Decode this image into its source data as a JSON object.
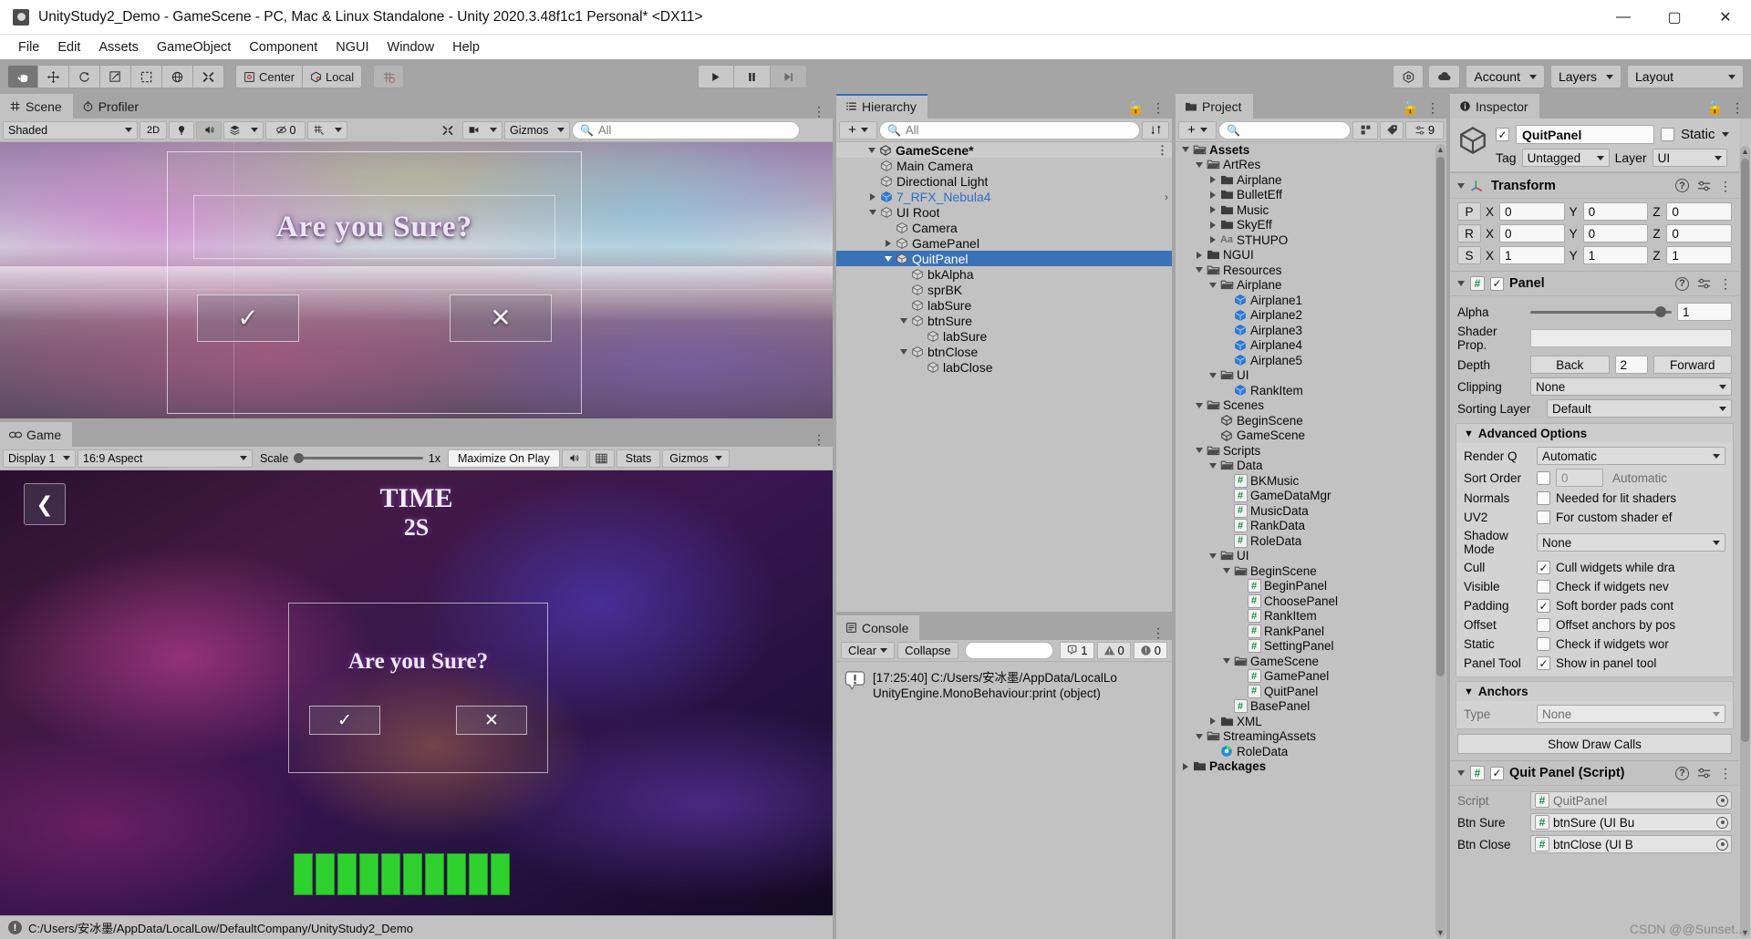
{
  "window": {
    "title": "UnityStudy2_Demo - GameScene - PC, Mac & Linux Standalone - Unity 2020.3.48f1c1 Personal* <DX11>",
    "minimize": "—",
    "maximize": "▢",
    "close": "✕"
  },
  "menu": {
    "items": [
      "File",
      "Edit",
      "Assets",
      "GameObject",
      "Component",
      "NGUI",
      "Window",
      "Help"
    ]
  },
  "toolbar": {
    "tools": [
      "hand-tool",
      "move-tool",
      "rotate-tool",
      "scale-tool",
      "rect-tool",
      "transform-tool",
      "custom-tool"
    ],
    "pivot_label": "Center",
    "space_label": "Local",
    "snap_label": "",
    "play": "▶",
    "pause": "❚❚",
    "step": "▶|",
    "collab_label": "",
    "account_label": "Account",
    "layers_label": "Layers",
    "layout_label": "Layout"
  },
  "scene_panel": {
    "tabs": [
      {
        "label": "Scene",
        "icon": "grid-icon",
        "selected": true
      },
      {
        "label": "Profiler",
        "icon": "stopwatch-icon",
        "selected": false
      }
    ],
    "toolbar": {
      "draw_mode": "Shaded",
      "two_d": "2D",
      "lighting": "light-icon",
      "audio": "audio-icon",
      "fx": "fx-icon",
      "hidden_count": "0",
      "grid": "grid-visibility-icon",
      "gizmos": "Gizmos",
      "search_placeholder": "All"
    },
    "overlay": {
      "dialog_title": "Are you Sure?",
      "confirm_glyph": "✓",
      "cancel_glyph": "✕"
    }
  },
  "game_panel": {
    "tab": {
      "label": "Game",
      "icon": "gamepad-icon"
    },
    "toolbar": {
      "display": "Display 1",
      "aspect": "16:9 Aspect",
      "scale_label": "Scale",
      "scale_value": "1x",
      "maximize": "Maximize On Play",
      "mute": "audio-icon",
      "stats_toggle": "grid-icon",
      "stats": "Stats",
      "gizmos": "Gizmos"
    },
    "overlay": {
      "time_label": "TIME",
      "time_value": "2S",
      "back_glyph": "❮",
      "dialog_title": "Are you Sure?",
      "confirm_glyph": "✓",
      "cancel_glyph": "✕",
      "hp_blocks": 10
    }
  },
  "statusbar": {
    "text": "C:/Users/安冰墨/AppData/LocalLow/DefaultCompany/UnityStudy2_Demo",
    "icon": "warning-icon"
  },
  "hierarchy": {
    "tab": {
      "label": "Hierarchy",
      "icon": "hierarchy-icon"
    },
    "toolbar": {
      "create_label": "+",
      "search_placeholder": "All"
    },
    "rows": [
      {
        "label": "GameScene*",
        "depth": 0,
        "icon": "unity-icon",
        "twisty": "open",
        "kind": "scene"
      },
      {
        "label": "Main Camera",
        "depth": 1,
        "icon": "cube-icon",
        "twisty": "none"
      },
      {
        "label": "Directional Light",
        "depth": 1,
        "icon": "cube-icon",
        "twisty": "none"
      },
      {
        "label": "7_RFX_Nebula4",
        "depth": 1,
        "icon": "prefab-icon",
        "twisty": "closed",
        "prefab": true,
        "chevron": true
      },
      {
        "label": "UI Root",
        "depth": 1,
        "icon": "cube-icon",
        "twisty": "open"
      },
      {
        "label": "Camera",
        "depth": 2,
        "icon": "cube-icon",
        "twisty": "none"
      },
      {
        "label": "GamePanel",
        "depth": 2,
        "icon": "cube-icon",
        "twisty": "closed"
      },
      {
        "label": "QuitPanel",
        "depth": 2,
        "icon": "cube-icon",
        "twisty": "open",
        "selected": true
      },
      {
        "label": "bkAlpha",
        "depth": 3,
        "icon": "cube-icon",
        "twisty": "none"
      },
      {
        "label": "sprBK",
        "depth": 3,
        "icon": "cube-icon",
        "twisty": "none"
      },
      {
        "label": "labSure",
        "depth": 3,
        "icon": "cube-icon",
        "twisty": "none"
      },
      {
        "label": "btnSure",
        "depth": 3,
        "icon": "cube-icon",
        "twisty": "open"
      },
      {
        "label": "labSure",
        "depth": 4,
        "icon": "cube-icon",
        "twisty": "none"
      },
      {
        "label": "btnClose",
        "depth": 3,
        "icon": "cube-icon",
        "twisty": "open"
      },
      {
        "label": "labClose",
        "depth": 4,
        "icon": "cube-icon",
        "twisty": "none"
      }
    ]
  },
  "console": {
    "tab": {
      "label": "Console",
      "icon": "console-icon"
    },
    "toolbar": {
      "clear": "Clear",
      "collapse": "Collapse",
      "error_count": "1",
      "warn_count": "0",
      "info_count": "0"
    },
    "entries": [
      {
        "line1": "[17:25:40] C:/Users/安冰墨/AppData/LocalLo",
        "line2": "UnityEngine.MonoBehaviour:print (object)"
      }
    ]
  },
  "project": {
    "tab": {
      "label": "Project",
      "icon": "folder-icon"
    },
    "toolbar": {
      "create_label": "+",
      "search_placeholder": ""
    },
    "rows": [
      {
        "label": "Assets",
        "depth": 0,
        "icon": "folder-open-icon",
        "twisty": "open",
        "bold": true
      },
      {
        "label": "ArtRes",
        "depth": 1,
        "icon": "folder-open-icon",
        "twisty": "open"
      },
      {
        "label": "Airplane",
        "depth": 2,
        "icon": "folder-icon",
        "twisty": "closed"
      },
      {
        "label": "BulletEff",
        "depth": 2,
        "icon": "folder-icon",
        "twisty": "closed"
      },
      {
        "label": "Music",
        "depth": 2,
        "icon": "folder-icon",
        "twisty": "closed"
      },
      {
        "label": "SkyEff",
        "depth": 2,
        "icon": "folder-icon",
        "twisty": "closed"
      },
      {
        "label": "STHUPO",
        "depth": 2,
        "icon": "font-icon",
        "twisty": "closed"
      },
      {
        "label": "NGUI",
        "depth": 1,
        "icon": "folder-icon",
        "twisty": "closed"
      },
      {
        "label": "Resources",
        "depth": 1,
        "icon": "folder-open-icon",
        "twisty": "open"
      },
      {
        "label": "Airplane",
        "depth": 2,
        "icon": "folder-open-icon",
        "twisty": "open"
      },
      {
        "label": "Airplane1",
        "depth": 3,
        "icon": "prefab-icon",
        "twisty": "none"
      },
      {
        "label": "Airplane2",
        "depth": 3,
        "icon": "prefab-icon",
        "twisty": "none"
      },
      {
        "label": "Airplane3",
        "depth": 3,
        "icon": "prefab-icon",
        "twisty": "none"
      },
      {
        "label": "Airplane4",
        "depth": 3,
        "icon": "prefab-icon",
        "twisty": "none"
      },
      {
        "label": "Airplane5",
        "depth": 3,
        "icon": "prefab-icon",
        "twisty": "none"
      },
      {
        "label": "UI",
        "depth": 2,
        "icon": "folder-open-icon",
        "twisty": "open"
      },
      {
        "label": "RankItem",
        "depth": 3,
        "icon": "prefab-icon",
        "twisty": "none"
      },
      {
        "label": "Scenes",
        "depth": 1,
        "icon": "folder-open-icon",
        "twisty": "open"
      },
      {
        "label": "BeginScene",
        "depth": 2,
        "icon": "unity-icon",
        "twisty": "none"
      },
      {
        "label": "GameScene",
        "depth": 2,
        "icon": "unity-icon",
        "twisty": "none"
      },
      {
        "label": "Scripts",
        "depth": 1,
        "icon": "folder-open-icon",
        "twisty": "open"
      },
      {
        "label": "Data",
        "depth": 2,
        "icon": "folder-open-icon",
        "twisty": "open"
      },
      {
        "label": "BKMusic",
        "depth": 3,
        "icon": "script-icon",
        "twisty": "none"
      },
      {
        "label": "GameDataMgr",
        "depth": 3,
        "icon": "script-icon",
        "twisty": "none"
      },
      {
        "label": "MusicData",
        "depth": 3,
        "icon": "script-icon",
        "twisty": "none"
      },
      {
        "label": "RankData",
        "depth": 3,
        "icon": "script-icon",
        "twisty": "none"
      },
      {
        "label": "RoleData",
        "depth": 3,
        "icon": "script-icon",
        "twisty": "none"
      },
      {
        "label": "UI",
        "depth": 2,
        "icon": "folder-open-icon",
        "twisty": "open"
      },
      {
        "label": "BeginScene",
        "depth": 3,
        "icon": "folder-open-icon",
        "twisty": "open"
      },
      {
        "label": "BeginPanel",
        "depth": 4,
        "icon": "script-icon",
        "twisty": "none"
      },
      {
        "label": "ChoosePanel",
        "depth": 4,
        "icon": "script-icon",
        "twisty": "none"
      },
      {
        "label": "RankItem",
        "depth": 4,
        "icon": "script-icon",
        "twisty": "none"
      },
      {
        "label": "RankPanel",
        "depth": 4,
        "icon": "script-icon",
        "twisty": "none"
      },
      {
        "label": "SettingPanel",
        "depth": 4,
        "icon": "script-icon",
        "twisty": "none"
      },
      {
        "label": "GameScene",
        "depth": 3,
        "icon": "folder-open-icon",
        "twisty": "open"
      },
      {
        "label": "GamePanel",
        "depth": 4,
        "icon": "script-icon",
        "twisty": "none"
      },
      {
        "label": "QuitPanel",
        "depth": 4,
        "icon": "script-icon",
        "twisty": "none"
      },
      {
        "label": "BasePanel",
        "depth": 3,
        "icon": "script-icon",
        "twisty": "none"
      },
      {
        "label": "XML",
        "depth": 2,
        "icon": "folder-icon",
        "twisty": "closed"
      },
      {
        "label": "StreamingAssets",
        "depth": 1,
        "icon": "folder-open-icon",
        "twisty": "open"
      },
      {
        "label": "RoleData",
        "depth": 2,
        "icon": "browser-icon",
        "twisty": "none"
      },
      {
        "label": "Packages",
        "depth": 0,
        "icon": "folder-icon",
        "twisty": "closed",
        "bold": true
      }
    ]
  },
  "inspector": {
    "tab": {
      "label": "Inspector",
      "icon": "info-icon"
    },
    "header": {
      "enabled": true,
      "name": "QuitPanel",
      "static_label": "Static",
      "static_checked": false,
      "tag_label": "Tag",
      "tag_value": "Untagged",
      "layer_label": "Layer",
      "layer_value": "UI"
    },
    "transform": {
      "title": "Transform",
      "rows": [
        {
          "badge": "P",
          "x": "0",
          "y": "0",
          "z": "0"
        },
        {
          "badge": "R",
          "x": "0",
          "y": "0",
          "z": "0"
        },
        {
          "badge": "S",
          "x": "1",
          "y": "1",
          "z": "1"
        }
      ]
    },
    "panel": {
      "title": "Panel",
      "enabled": true,
      "alpha_label": "Alpha",
      "alpha_value": "1",
      "shader_label": "Shader Prop.",
      "shader_value": "",
      "depth_label": "Depth",
      "depth_back": "Back",
      "depth_value": "2",
      "depth_forward": "Forward",
      "clipping_label": "Clipping",
      "clipping_value": "None",
      "sorting_label": "Sorting Layer",
      "sorting_value": "Default",
      "advanced_title": "Advanced Options",
      "advanced": [
        {
          "label": "Render Q",
          "type": "dropdown",
          "value": "Automatic"
        },
        {
          "label": "Sort Order",
          "type": "checknum",
          "checked": false,
          "num": "0",
          "hint": "Automatic"
        },
        {
          "label": "Normals",
          "type": "checktext",
          "checked": false,
          "text": "Needed for lit shaders"
        },
        {
          "label": "UV2",
          "type": "checktext",
          "checked": false,
          "text": "For custom shader ef"
        },
        {
          "label": "Shadow Mode",
          "type": "dropdown",
          "value": "None"
        },
        {
          "label": "Cull",
          "type": "checktext",
          "checked": true,
          "text": "Cull widgets while dra"
        },
        {
          "label": "Visible",
          "type": "checktext",
          "checked": false,
          "text": "Check if widgets nev"
        },
        {
          "label": "Padding",
          "type": "checktext",
          "checked": true,
          "text": "Soft border pads cont"
        },
        {
          "label": "Offset",
          "type": "checktext",
          "checked": false,
          "text": "Offset anchors by pos"
        },
        {
          "label": "Static",
          "type": "checktext",
          "checked": false,
          "text": "Check if widgets wor"
        },
        {
          "label": "Panel Tool",
          "type": "checktext",
          "checked": true,
          "text": "Show in panel tool"
        }
      ],
      "anchors_title": "Anchors",
      "anchor_type_label": "Type",
      "anchor_type_value": "None",
      "draw_calls_button": "Show Draw Calls"
    },
    "script_component": {
      "title": "Quit Panel (Script)",
      "enabled": true,
      "rows": [
        {
          "label": "Script",
          "value": "QuitPanel",
          "dim": true
        },
        {
          "label": "Btn Sure",
          "value": "btnSure (UI Bu",
          "dim": false
        },
        {
          "label": "Btn Close",
          "value": "btnClose (UI B",
          "dim": false
        }
      ]
    }
  },
  "watermark": {
    "text": "CSDN @@Sunset..."
  }
}
